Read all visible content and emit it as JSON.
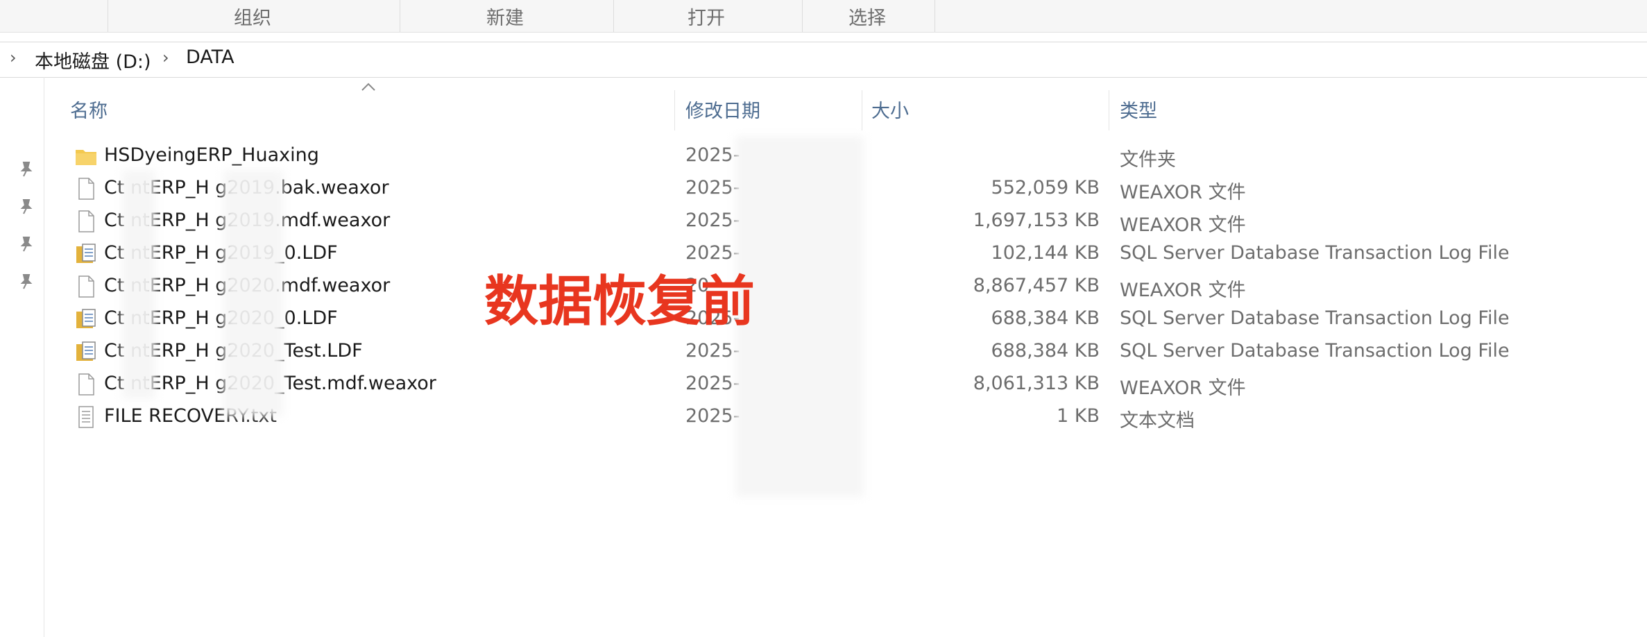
{
  "ribbon": {
    "groups": [
      "组织",
      "新建",
      "打开",
      "选择"
    ]
  },
  "address_bar": {
    "crumbs": [
      "本地磁盘 (D:)",
      "DATA"
    ]
  },
  "columns": {
    "name": "名称",
    "date": "修改日期",
    "size": "大小",
    "type": "类型"
  },
  "files": [
    {
      "name": "HSDyeingERP_Huaxing",
      "date": "2025-",
      "size": "",
      "type": "文件夹",
      "icon": "folder-icon"
    },
    {
      "name": "Ct      ntERP_H          g2019.bak.weaxor",
      "date": "2025-",
      "size": "552,059 KB",
      "type": "WEAXOR 文件",
      "icon": "file-icon"
    },
    {
      "name": "Ct      ntERP_H          g2019.mdf.weaxor",
      "date": "2025-",
      "size": "1,697,153 KB",
      "type": "WEAXOR 文件",
      "icon": "file-icon"
    },
    {
      "name": "Ct      ntERP_H          g2019_0.LDF",
      "date": "2025-",
      "size": "102,144 KB",
      "type": "SQL Server Database Transaction Log File",
      "icon": "sql-log-icon"
    },
    {
      "name": "Ct      ntERP_H          g2020.mdf.weaxor",
      "date": "20",
      "size": "8,867,457 KB",
      "type": "WEAXOR 文件",
      "icon": "file-icon"
    },
    {
      "name": "Ct      ntERP_H          g2020_0.LDF",
      "date": "2025-",
      "size": "688,384 KB",
      "type": "SQL Server Database Transaction Log File",
      "icon": "sql-log-icon"
    },
    {
      "name": "Ct      ntERP_H          g2020_Test.LDF",
      "date": "2025-",
      "size": "688,384 KB",
      "type": "SQL Server Database Transaction Log File",
      "icon": "sql-log-icon"
    },
    {
      "name": "Ct      ntERP_H          g2020_Test.mdf.weaxor",
      "date": "2025-",
      "size": "8,061,313 KB",
      "type": "WEAXOR 文件",
      "icon": "file-icon"
    },
    {
      "name": "FILE RECOVERY.txt",
      "date": "2025-",
      "size": "1 KB",
      "type": "文本文档",
      "icon": "text-file-icon"
    }
  ],
  "annotation": "数据恢复前",
  "colors": {
    "annotation": "#e8361f",
    "header_text": "#4d6c90",
    "folder": "#f3c94f"
  }
}
